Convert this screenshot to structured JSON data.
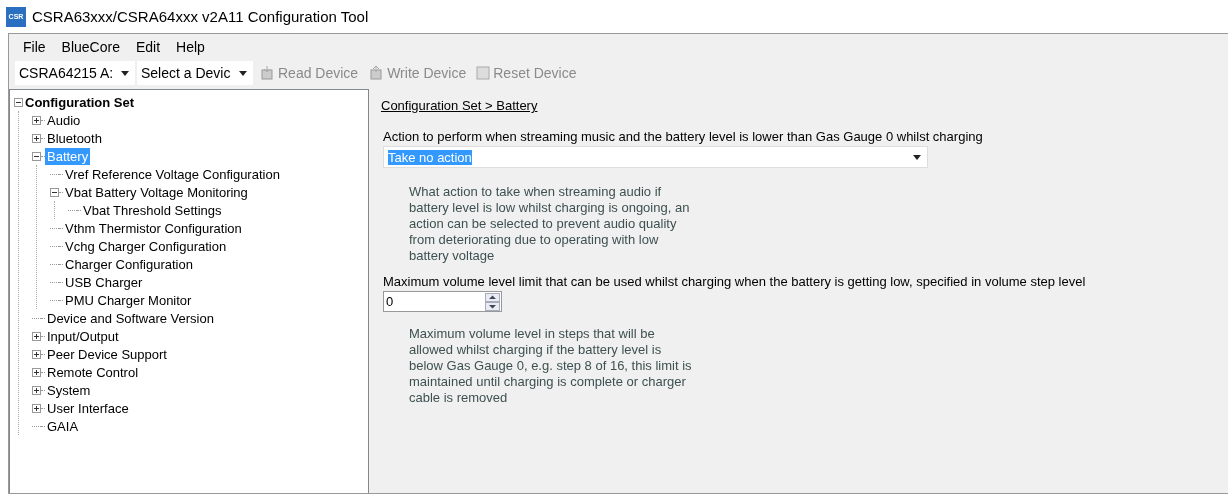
{
  "window": {
    "title": "CSRA63xxx/CSRA64xxx v2A11 Configuration Tool",
    "logo": "CSR"
  },
  "menu": [
    "File",
    "BlueCore",
    "Edit",
    "Help"
  ],
  "toolbar": {
    "combos": [
      {
        "value": "CSRA64215 A:"
      },
      {
        "value": "Select a Devic"
      }
    ],
    "buttons": [
      {
        "label": "Read Device",
        "disabled": true,
        "kind": "read"
      },
      {
        "label": "Write Device",
        "disabled": true,
        "kind": "write"
      },
      {
        "label": "Reset Device",
        "disabled": true,
        "kind": "reset"
      }
    ]
  },
  "tree": [
    {
      "label": "Configuration Set",
      "expanded": true,
      "selected": false,
      "children": [
        {
          "label": "Audio",
          "expanded": false,
          "selected": false
        },
        {
          "label": "Bluetooth",
          "expanded": false,
          "selected": false
        },
        {
          "label": "Battery",
          "expanded": true,
          "selected": true,
          "children": [
            {
              "label": "Vref Reference Voltage Configuration",
              "selected": false
            },
            {
              "label": "Vbat Battery Voltage Monitoring",
              "expanded": true,
              "selected": false,
              "children": [
                {
                  "label": "Vbat Threshold Settings",
                  "selected": false
                }
              ]
            },
            {
              "label": "Vthm Thermistor Configuration",
              "selected": false
            },
            {
              "label": "Vchg Charger Configuration",
              "selected": false
            },
            {
              "label": "Charger Configuration",
              "selected": false
            },
            {
              "label": "USB Charger",
              "selected": false
            },
            {
              "label": "PMU Charger Monitor",
              "selected": false
            }
          ]
        },
        {
          "label": "Device and Software Version",
          "selected": false
        },
        {
          "label": "Input/Output",
          "expanded": false,
          "selected": false
        },
        {
          "label": "Peer Device Support",
          "expanded": false,
          "selected": false
        },
        {
          "label": "Remote Control",
          "expanded": false,
          "selected": false
        },
        {
          "label": "System",
          "expanded": false,
          "selected": false
        },
        {
          "label": "User Interface",
          "expanded": false,
          "selected": false
        },
        {
          "label": "GAIA",
          "selected": false
        }
      ]
    }
  ],
  "content": {
    "breadcrumb": "Configuration Set > Battery",
    "settings": [
      {
        "kind": "dropdown",
        "label": "Action to perform when streaming music and the battery level is lower than Gas Gauge 0 whilst charging",
        "value": "Take no action",
        "description": "What action to take when streaming audio if battery level is low whilst charging is ongoing, an action can be selected to prevent audio quality from deteriorating due to operating with low battery voltage"
      },
      {
        "kind": "spinner",
        "label": "Maximum volume level limit that can be used whilst charging when the battery is getting low, specified in volume step level",
        "value": "0",
        "description": "Maximum volume level in steps that will be allowed whilst charging if the battery level is below Gas Gauge 0, e.g. step 8 of 16, this limit is maintained until charging is complete or charger cable is removed"
      }
    ]
  }
}
